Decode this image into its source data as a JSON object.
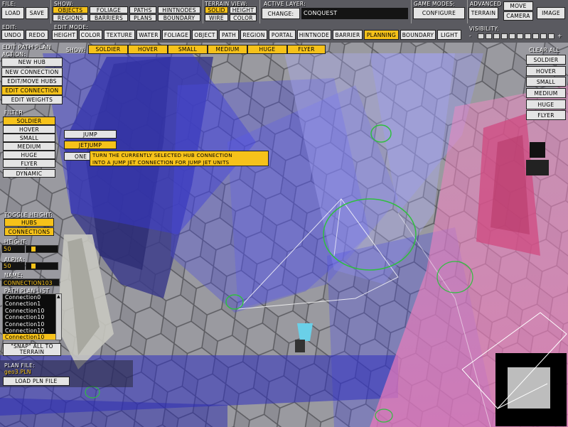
{
  "file": {
    "label": "File:",
    "load": "Load",
    "save": "Save"
  },
  "show": {
    "label": "Show:",
    "row1": [
      "Objects",
      "Foliage",
      "Paths",
      "HintNodes"
    ],
    "row2": [
      "Regions",
      "Barriers",
      "Plans",
      "Boundary"
    ]
  },
  "terrain_view": {
    "label": "Terrain View:",
    "row1": [
      "Solid",
      "Height"
    ],
    "row2": [
      "Wire",
      "Color"
    ]
  },
  "active_layer": {
    "label": "Active Layer:",
    "change": "Change:",
    "value": "conquest"
  },
  "game_modes": {
    "label": "Game Modes:",
    "configure": "Configure"
  },
  "advanced": {
    "label": "Advanced",
    "terrain": "Terrain",
    "move": "Move",
    "camera": "Camera",
    "image": "Image"
  },
  "edit": {
    "label": "Edit:",
    "undo": "Undo",
    "redo": "Redo"
  },
  "edit_mode": {
    "label": "Edit Mode:",
    "items": [
      "Height",
      "Color",
      "Texture",
      "Water",
      "Foliage",
      "Object",
      "Path",
      "Region",
      "Portal",
      "HintNode",
      "Barrier",
      "Planning",
      "Boundary",
      "Light"
    ]
  },
  "visibility": {
    "label": "Visibility:",
    "minus": "-",
    "plus": "+"
  },
  "panel": {
    "title": "Edit Path Plan",
    "action_label": "Action:",
    "actions": [
      "New Hub",
      "New Connection",
      "Edit/Move Hubs",
      "Edit Connection",
      "Edit Weights"
    ],
    "filter_label": "Filter",
    "filters": [
      "Soldier",
      "Hover",
      "Small",
      "Medium",
      "Huge",
      "Flyer"
    ],
    "dynamic": "Dynamic",
    "toggle_height": "Toggle Height:",
    "hubs": "Hubs",
    "connections": "Connections",
    "height_label": "Height:",
    "height_value": "50",
    "height_level": 0.18,
    "alpha_label": "Alpha:",
    "alpha_value": "50",
    "alpha_level": 0.18,
    "name_label": "Name:",
    "name_value": "Connection103",
    "list_label": "Path Plan List",
    "list_items": [
      "Connection0",
      "Connection1",
      "Connection10",
      "Connection10",
      "Connection10",
      "Connection10",
      "Connection10"
    ],
    "list_scroll": "▲",
    "snap": [
      "\"Snap\" All To",
      "Terrain"
    ],
    "plan_file_label": "Plan File:",
    "plan_file_value": "geo3.PLN",
    "load_pln": "Load PLN File"
  },
  "show_bar": {
    "label": "Show:",
    "items": [
      "Soldier",
      "Hover",
      "Small",
      "Medium",
      "Huge",
      "Flyer"
    ]
  },
  "right_panel": {
    "clear_all": "Clear All",
    "items": [
      "Soldier",
      "Hover",
      "Small",
      "Medium",
      "Huge",
      "Flyer"
    ]
  },
  "popup": {
    "jump": "Jump",
    "jetjump": "JetJump",
    "one": "One",
    "tooltip_line1": "Turn the currently selected hub connection",
    "tooltip_line2": "into a jump jet connection for jump jet units"
  },
  "colors": {
    "accent": "#f6c21a",
    "button": "#e4e4e4",
    "topbar": "#5a5a60"
  }
}
